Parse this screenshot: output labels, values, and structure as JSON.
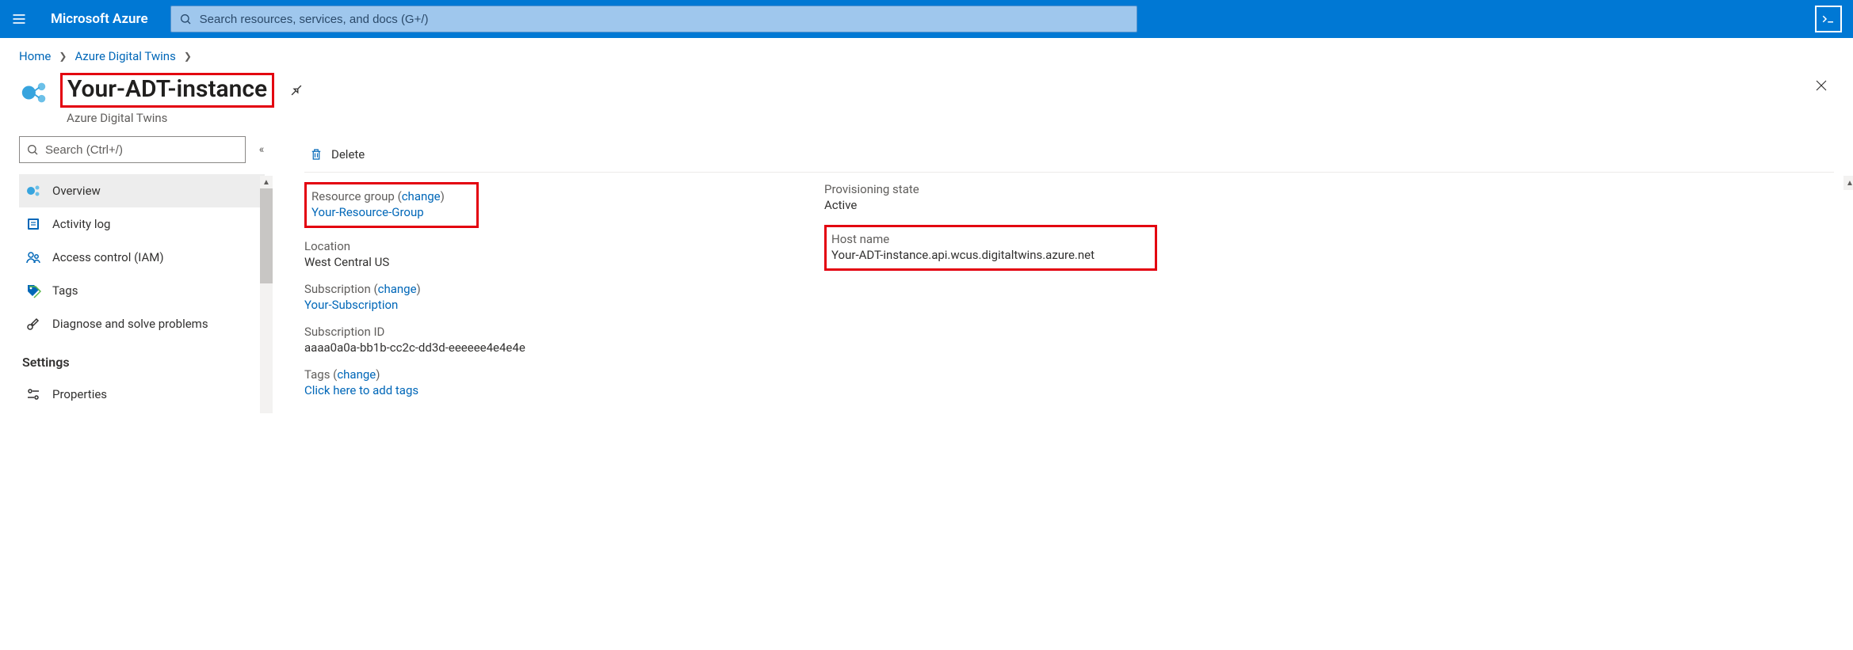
{
  "topbar": {
    "brand": "Microsoft Azure",
    "search_placeholder": "Search resources, services, and docs (G+/)"
  },
  "breadcrumb": {
    "items": [
      "Home",
      "Azure Digital Twins"
    ]
  },
  "header": {
    "title": "Your-ADT-instance",
    "subtitle": "Azure Digital Twins"
  },
  "sidebar": {
    "search_placeholder": "Search (Ctrl+/)",
    "items": [
      {
        "label": "Overview"
      },
      {
        "label": "Activity log"
      },
      {
        "label": "Access control (IAM)"
      },
      {
        "label": "Tags"
      },
      {
        "label": "Diagnose and solve problems"
      }
    ],
    "section_settings": "Settings",
    "settings_items": [
      {
        "label": "Properties"
      }
    ]
  },
  "toolbar": {
    "delete_label": "Delete"
  },
  "essentials": {
    "left": {
      "resource_group_label": "Resource group",
      "change_text": "change",
      "resource_group_value": "Your-Resource-Group",
      "location_label": "Location",
      "location_value": "West Central US",
      "subscription_label": "Subscription",
      "subscription_value": "Your-Subscription",
      "subscription_id_label": "Subscription ID",
      "subscription_id_value": "aaaa0a0a-bb1b-cc2c-dd3d-eeeeee4e4e4e",
      "tags_label": "Tags",
      "tags_value": "Click here to add tags"
    },
    "right": {
      "provisioning_label": "Provisioning state",
      "provisioning_value": "Active",
      "hostname_label": "Host name",
      "hostname_value": "Your-ADT-instance.api.wcus.digitaltwins.azure.net"
    }
  }
}
